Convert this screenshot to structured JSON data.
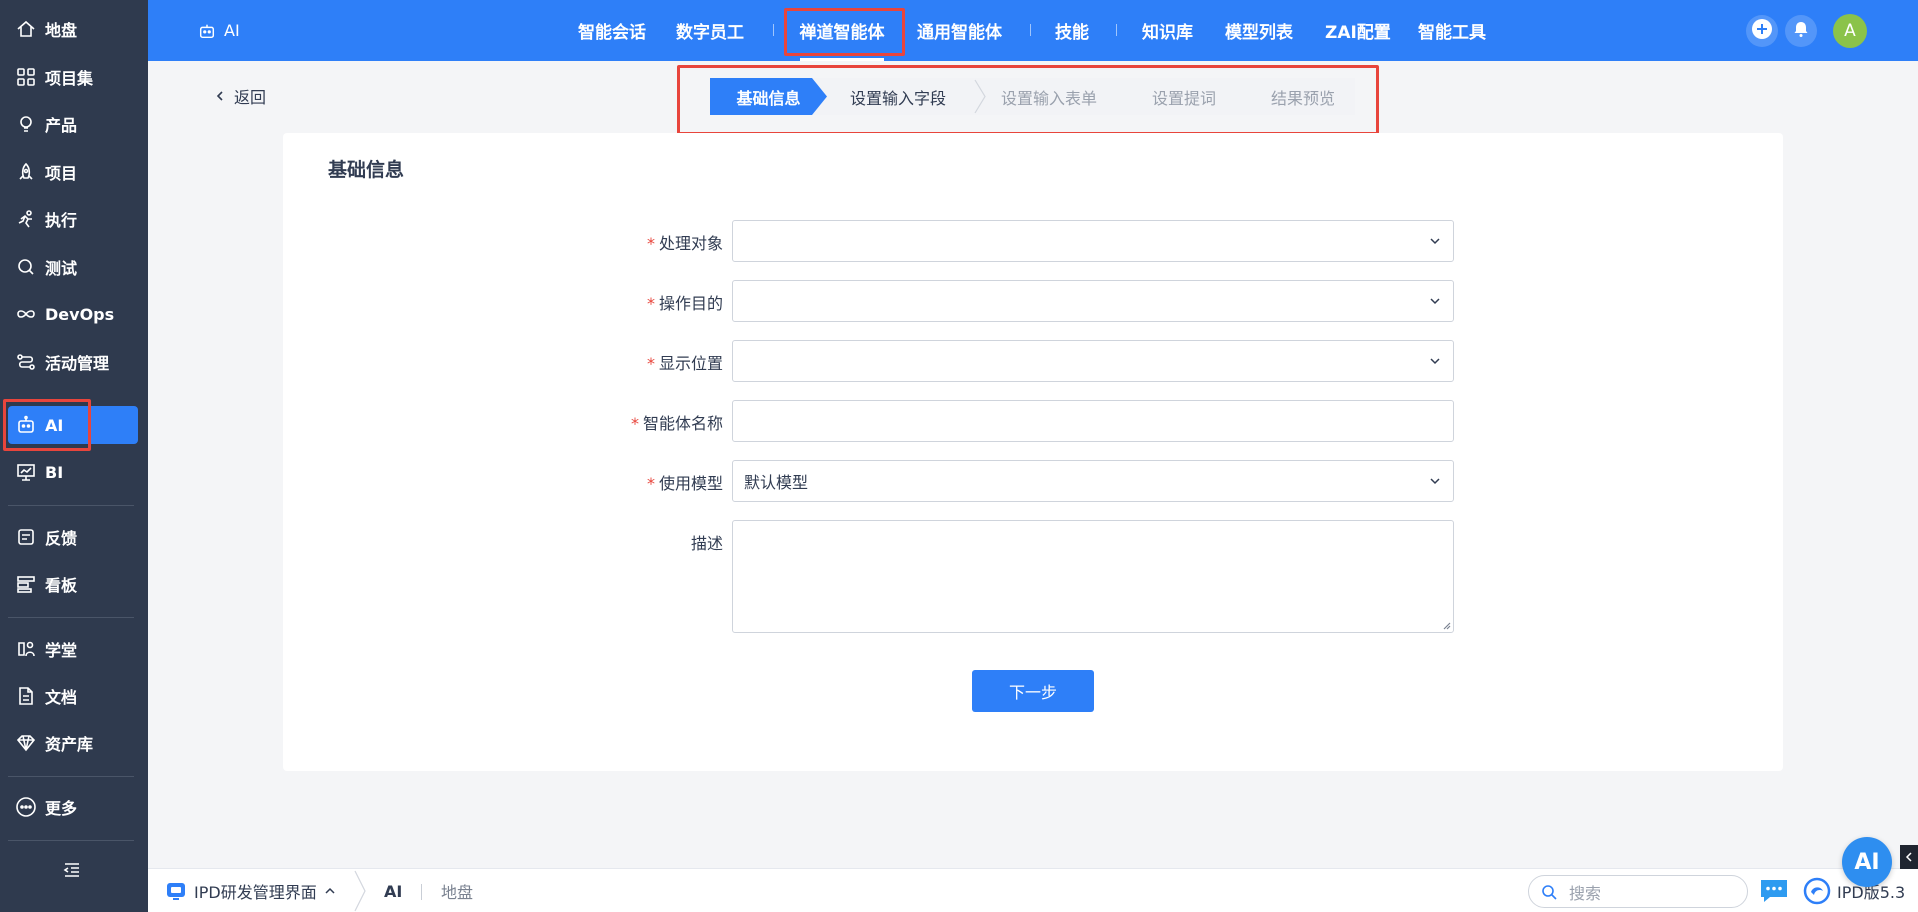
{
  "sidebar": {
    "items": [
      {
        "label": "地盘",
        "icon": "home-icon"
      },
      {
        "label": "项目集",
        "icon": "grid-icon"
      },
      {
        "label": "产品",
        "icon": "bulb-icon"
      },
      {
        "label": "项目",
        "icon": "rocket-icon"
      },
      {
        "label": "执行",
        "icon": "run-icon"
      },
      {
        "label": "测试",
        "icon": "test-icon"
      },
      {
        "label": "DevOps",
        "icon": "infinity-icon"
      },
      {
        "label": "活动管理",
        "icon": "flow-icon"
      },
      {
        "label": "AI",
        "icon": "robot-icon"
      },
      {
        "label": "BI",
        "icon": "chart-icon"
      },
      {
        "label": "反馈",
        "icon": "feedback-icon"
      },
      {
        "label": "看板",
        "icon": "board-icon"
      },
      {
        "label": "学堂",
        "icon": "school-icon"
      },
      {
        "label": "文档",
        "icon": "doc-icon"
      },
      {
        "label": "资产库",
        "icon": "diamond-icon"
      },
      {
        "label": "更多",
        "icon": "more-icon"
      }
    ],
    "active": "AI"
  },
  "topbar": {
    "app_label": "AI",
    "nav": [
      "智能会话",
      "数字员工",
      "禅道智能体",
      "通用智能体",
      "技能",
      "知识库",
      "模型列表",
      "ZAI配置",
      "智能工具"
    ],
    "active_nav": "禅道智能体",
    "avatar_letter": "A"
  },
  "back_label": "返回",
  "steps": [
    "基础信息",
    "设置输入字段",
    "设置输入表单",
    "设置提词",
    "结果预览"
  ],
  "form": {
    "title": "基础信息",
    "fields": [
      {
        "label": "处理对象",
        "required": true,
        "value": "",
        "type": "select"
      },
      {
        "label": "操作目的",
        "required": true,
        "value": "",
        "type": "select"
      },
      {
        "label": "显示位置",
        "required": true,
        "value": "",
        "type": "select"
      },
      {
        "label": "智能体名称",
        "required": true,
        "value": "",
        "type": "input"
      },
      {
        "label": "使用模型",
        "required": true,
        "value": "默认模型",
        "type": "select"
      },
      {
        "label": "描述",
        "required": false,
        "value": "",
        "type": "textarea"
      }
    ],
    "next_button": "下一步"
  },
  "bottombar": {
    "app_name": "IPD研发管理界面",
    "crumbs": [
      "AI",
      "地盘"
    ],
    "search_placeholder": "搜索",
    "version": "IPD版5.3"
  },
  "ai_float_label": "AI",
  "colors": {
    "primary": "#2e7ff8",
    "sidebar": "#2f3a4e",
    "highlight": "#e8453c",
    "required": "#e8453c"
  }
}
